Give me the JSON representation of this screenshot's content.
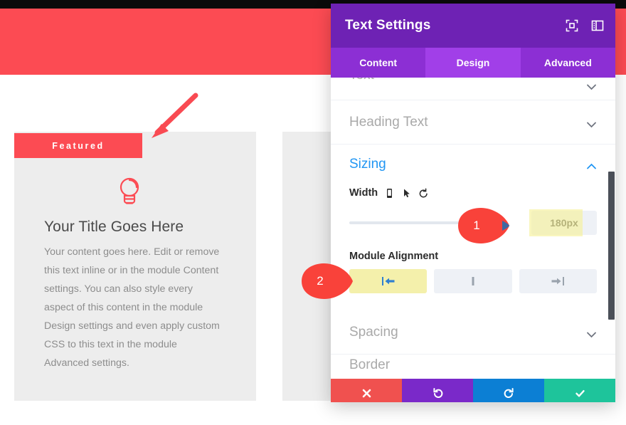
{
  "page": {
    "card": {
      "badge_label": "Featured",
      "icon": "lightbulb-icon",
      "title": "Your Title Goes Here",
      "body": "Your content goes here. Edit or remove this text inline or in the module Content settings. You can also style every aspect of this content in the module Design settings and even apply custom CSS to this text in the module Advanced settings.",
      "accent_color": "#fc4b53",
      "background_color": "#ededed"
    }
  },
  "annotations": {
    "arrow": {
      "name": "arrow-pointing-to-featured-badge",
      "color": "#f94a52"
    },
    "markers": [
      {
        "label": "1",
        "target": "width-value-field"
      },
      {
        "label": "2",
        "target": "module-alignment-left-button"
      }
    ]
  },
  "modal": {
    "title": "Text Settings",
    "header_icons": [
      {
        "name": "focus-expand-icon"
      },
      {
        "name": "panel-layout-icon"
      }
    ],
    "tabs": [
      {
        "label": "Content",
        "active": false
      },
      {
        "label": "Design",
        "active": true
      },
      {
        "label": "Advanced",
        "active": false
      }
    ],
    "sections": [
      {
        "label": "Text",
        "open": false,
        "clipped": true
      },
      {
        "label": "Heading Text",
        "open": false
      },
      {
        "label": "Sizing",
        "open": true
      },
      {
        "label": "Spacing",
        "open": false
      },
      {
        "label": "Border",
        "open": false,
        "clipped": true
      }
    ],
    "sizing": {
      "width": {
        "label": "Width",
        "icons": [
          "mobile-responsive-icon",
          "hover-cursor-icon",
          "reset-icon"
        ],
        "value": "180px",
        "placeholder": "180px",
        "slider_fill_percent": 0
      },
      "module_alignment": {
        "label": "Module Alignment",
        "options": [
          {
            "name": "align-left",
            "active": true
          },
          {
            "name": "align-center",
            "active": false
          },
          {
            "name": "align-right",
            "active": false
          }
        ]
      }
    },
    "footer": [
      {
        "name": "cancel-button",
        "icon": "close-icon",
        "color": "#f0514f"
      },
      {
        "name": "undo-button",
        "icon": "undo-icon",
        "color": "#7a29c9"
      },
      {
        "name": "redo-button",
        "icon": "redo-icon",
        "color": "#0c7fd4"
      },
      {
        "name": "save-button",
        "icon": "check-icon",
        "color": "#1ec49b"
      }
    ]
  }
}
